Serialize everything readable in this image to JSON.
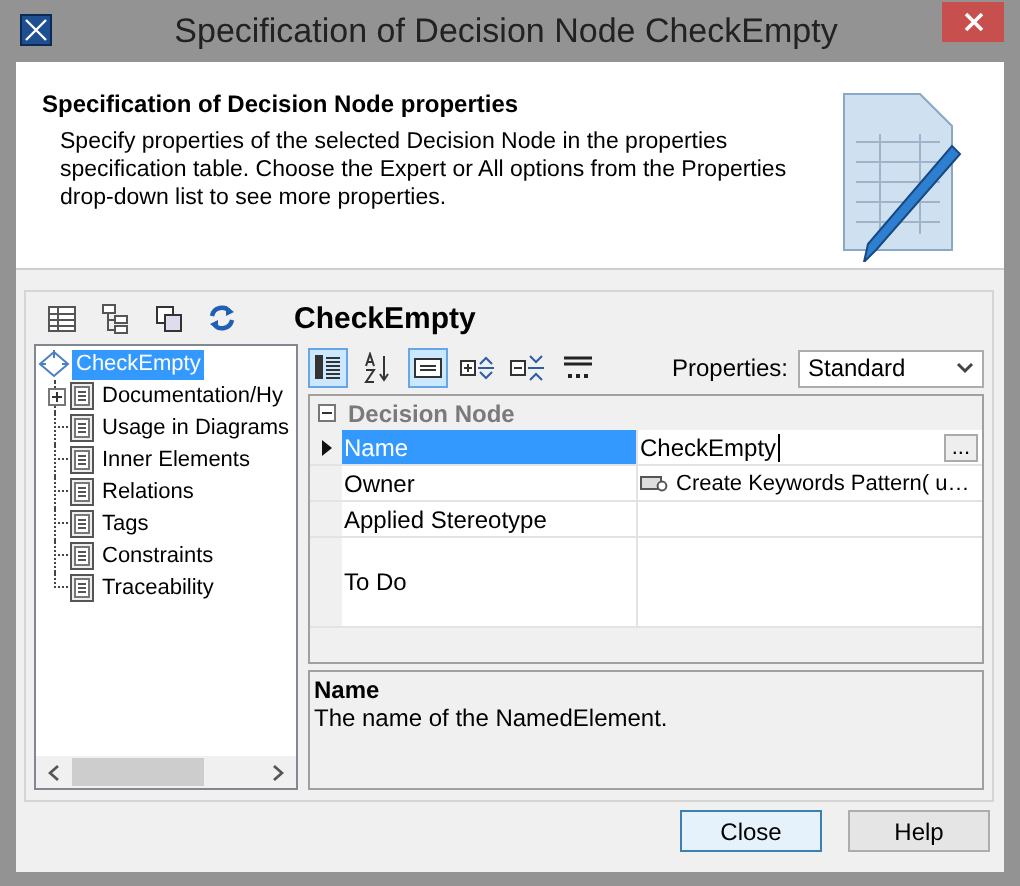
{
  "window": {
    "title": "Specification of Decision Node CheckEmpty"
  },
  "header": {
    "title": "Specification of Decision Node properties",
    "description": "Specify properties of the selected Decision Node in the properties specification table. Choose the Expert or All options from the Properties drop-down list to see more properties."
  },
  "element_title": "CheckEmpty",
  "tree": {
    "label": "CheckEmpty",
    "selected": true,
    "children": [
      {
        "label": "Documentation/Hy",
        "expandable": true,
        "selected": false
      },
      {
        "label": "Usage in Diagrams",
        "expandable": false,
        "selected": false
      },
      {
        "label": "Inner Elements",
        "expandable": false,
        "selected": false
      },
      {
        "label": "Relations",
        "expandable": false,
        "selected": false
      },
      {
        "label": "Tags",
        "expandable": false,
        "selected": false
      },
      {
        "label": "Constraints",
        "expandable": false,
        "selected": false
      },
      {
        "label": "Traceability",
        "expandable": false,
        "selected": false
      }
    ]
  },
  "toolbar": [
    {
      "kind": "categorized",
      "on": true
    },
    {
      "kind": "sort",
      "on": false
    },
    {
      "kind": "description",
      "on": true
    },
    {
      "kind": "expand",
      "on": false
    },
    {
      "kind": "collapse",
      "on": false
    },
    {
      "kind": "abc",
      "on": false
    }
  ],
  "properties_filter": {
    "label": "Properties:",
    "value": "Standard"
  },
  "table": {
    "group": "Decision Node",
    "rows": [
      {
        "name": "Name",
        "value": "CheckEmpty",
        "selected": true,
        "kind": "edit",
        "button": "..."
      },
      {
        "name": "Owner",
        "value": "Create Keywords Pattern( u…",
        "selected": false,
        "kind": "element"
      },
      {
        "name": "Applied Stereotype",
        "selected": false,
        "kind": "plain"
      },
      {
        "name": "To Do",
        "selected": false,
        "kind": "tall"
      }
    ]
  },
  "description": {
    "title": "Name",
    "text": "The name of the NamedElement."
  },
  "buttons": [
    {
      "label": "Close",
      "selected": true
    },
    {
      "label": "Help",
      "selected": false
    }
  ]
}
